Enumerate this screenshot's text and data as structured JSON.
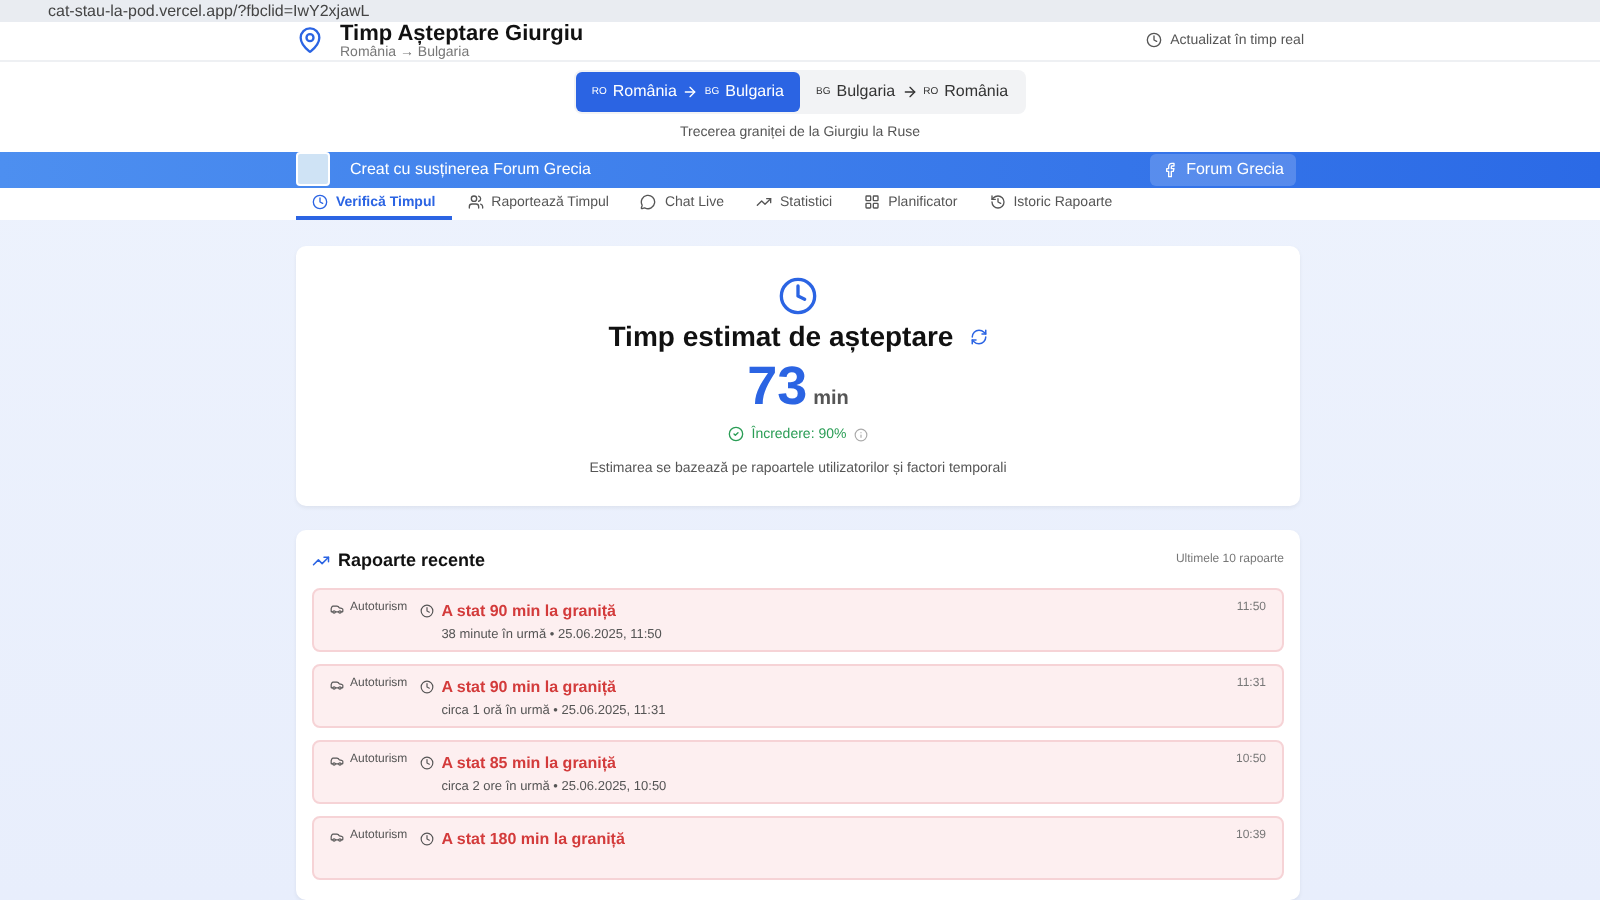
{
  "browser": {
    "url": "cat-stau-la-pod.vercel.app/?fbclid=IwY2xjawL"
  },
  "header": {
    "title": "Timp Așteptare Giurgiu",
    "subtitle": "România → Bulgaria",
    "status": "Actualizat în timp real"
  },
  "directions": [
    {
      "from_code": "RO",
      "from": "România",
      "to_code": "BG",
      "to": "Bulgaria",
      "selected": true
    },
    {
      "from_code": "BG",
      "from": "Bulgaria",
      "to_code": "RO",
      "to": "România",
      "selected": false
    }
  ],
  "crossing_caption": "Trecerea graniței de la Giurgiu la Ruse",
  "banner": {
    "text": "Creat cu susținerea Forum Grecia",
    "button": "Forum Grecia"
  },
  "tabs": [
    {
      "label": "Verifică Timpul",
      "selected": true
    },
    {
      "label": "Raportează Timpul",
      "selected": false
    },
    {
      "label": "Chat Live",
      "selected": false
    },
    {
      "label": "Statistici",
      "selected": false
    },
    {
      "label": "Planificator",
      "selected": false
    },
    {
      "label": "Istoric Rapoarte",
      "selected": false
    }
  ],
  "estimate": {
    "title": "Timp estimat de așteptare",
    "value": "73",
    "unit": "min",
    "confidence": "Încredere: 90%",
    "note": "Estimarea se bazează pe rapoartele utilizatorilor și factori temporali"
  },
  "reports": {
    "title": "Rapoarte recente",
    "count": "Ultimele 10 rapoarte",
    "items": [
      {
        "vehicle": "Autoturism",
        "title": "A stat 90 min la graniță",
        "meta": "38 minute în urmă • 25.06.2025, 11:50",
        "time": "11:50"
      },
      {
        "vehicle": "Autoturism",
        "title": "A stat 90 min la graniță",
        "meta": "circa 1 oră în urmă • 25.06.2025, 11:31",
        "time": "11:31"
      },
      {
        "vehicle": "Autoturism",
        "title": "A stat 85 min la graniță",
        "meta": "circa 2 ore în urmă • 25.06.2025, 10:50",
        "time": "10:50"
      },
      {
        "vehicle": "Autoturism",
        "title": "A stat 180 min la graniță",
        "time": "10:39"
      }
    ]
  }
}
